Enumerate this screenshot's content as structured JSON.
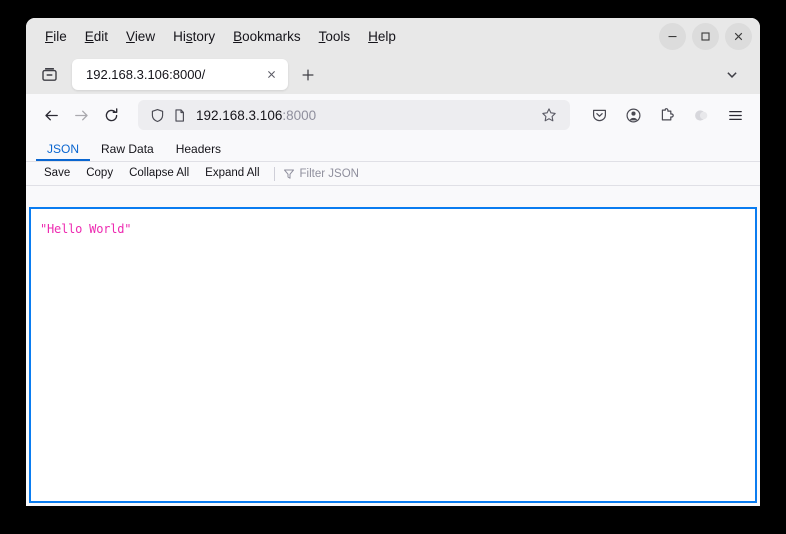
{
  "window": {
    "controls": {
      "minimize_label": "Minimize",
      "maximize_label": "Maximize",
      "close_label": "Close"
    }
  },
  "menubar": {
    "items": [
      {
        "label": "File",
        "mnemonic": "F"
      },
      {
        "label": "Edit",
        "mnemonic": "E"
      },
      {
        "label": "View",
        "mnemonic": "V"
      },
      {
        "label": "History",
        "mnemonic": "s"
      },
      {
        "label": "Bookmarks",
        "mnemonic": "B"
      },
      {
        "label": "Tools",
        "mnemonic": "T"
      },
      {
        "label": "Help",
        "mnemonic": "H"
      }
    ]
  },
  "tabstrip": {
    "firefox_view_icon": "firefox-view-icon",
    "active_tab": {
      "title": "192.168.3.106:8000/",
      "close_icon": "close-icon"
    },
    "new_tab_icon": "plus-icon",
    "list_all_tabs_icon": "chevron-down-icon"
  },
  "navbar": {
    "back_icon": "back-arrow-icon",
    "forward_icon": "forward-arrow-icon",
    "reload_icon": "reload-icon",
    "forward_disabled": true,
    "urlbar": {
      "shield_icon": "shield-icon",
      "page_icon": "page-icon",
      "host": "192.168.3.106",
      "port": ":8000",
      "bookmark_icon": "star-icon"
    },
    "buttons": [
      {
        "icon": "pocket-icon"
      },
      {
        "icon": "account-icon"
      },
      {
        "icon": "extensions-icon"
      },
      {
        "icon": "containers-icon"
      },
      {
        "icon": "hamburger-menu-icon"
      }
    ]
  },
  "viewer": {
    "tabs": [
      {
        "label": "JSON",
        "active": true
      },
      {
        "label": "Raw Data",
        "active": false
      },
      {
        "label": "Headers",
        "active": false
      }
    ],
    "toolbar": {
      "save_label": "Save",
      "copy_label": "Copy",
      "collapse_all_label": "Collapse All",
      "expand_all_label": "Expand All",
      "filter_icon": "filter-icon",
      "filter_placeholder": "Filter JSON"
    },
    "content": {
      "json_text": "\"Hello World\""
    }
  },
  "colors": {
    "accent_blue": "#0a66d0",
    "focus_border": "#0a7cf0",
    "json_string": "#ed2bb1",
    "chrome_bg": "#f9f9fb",
    "tabbar_bg": "#e8e8e8"
  }
}
